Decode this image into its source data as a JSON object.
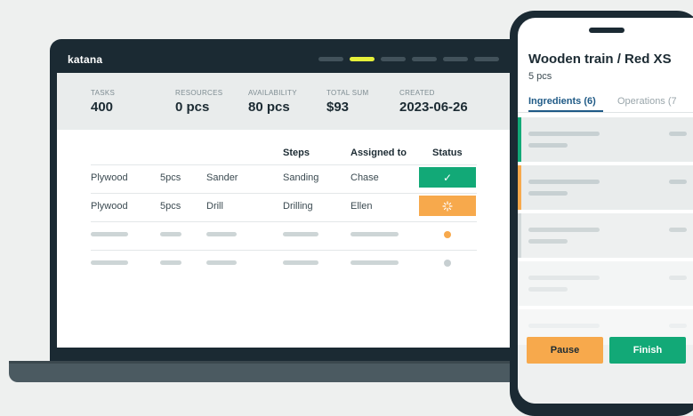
{
  "laptop": {
    "brand": "katana",
    "summary": {
      "tasks": {
        "label": "TASKS",
        "value": "400"
      },
      "resources": {
        "label": "RESOURCES",
        "value": "0 pcs"
      },
      "availability": {
        "label": "AVAILABILITY",
        "value": "80 pcs"
      },
      "total_sum": {
        "label": "TOTAL SUM",
        "value": "$93"
      },
      "created": {
        "label": "CREATED",
        "value": "2023-06-26"
      }
    },
    "table": {
      "headers": {
        "steps": "Steps",
        "assigned": "Assigned to",
        "status": "Status"
      },
      "rows": [
        {
          "material": "Plywood",
          "qty": "5pcs",
          "tool": "Sander",
          "step": "Sanding",
          "assigned": "Chase",
          "status_icon": "check-icon"
        },
        {
          "material": "Plywood",
          "qty": "5pcs",
          "tool": "Drill",
          "step": "Drilling",
          "assigned": "Ellen",
          "status_icon": "spinner-icon"
        }
      ]
    },
    "colors": {
      "done": "#12a977",
      "in_progress": "#f7a94c",
      "accent": "#e6f03a"
    }
  },
  "phone": {
    "title": "Wooden train / Red XS",
    "subtitle": "5 pcs",
    "tabs": {
      "ingredients": "Ingredients (6)",
      "operations": "Operations (7"
    },
    "buttons": {
      "pause": "Pause",
      "finish": "Finish"
    }
  }
}
